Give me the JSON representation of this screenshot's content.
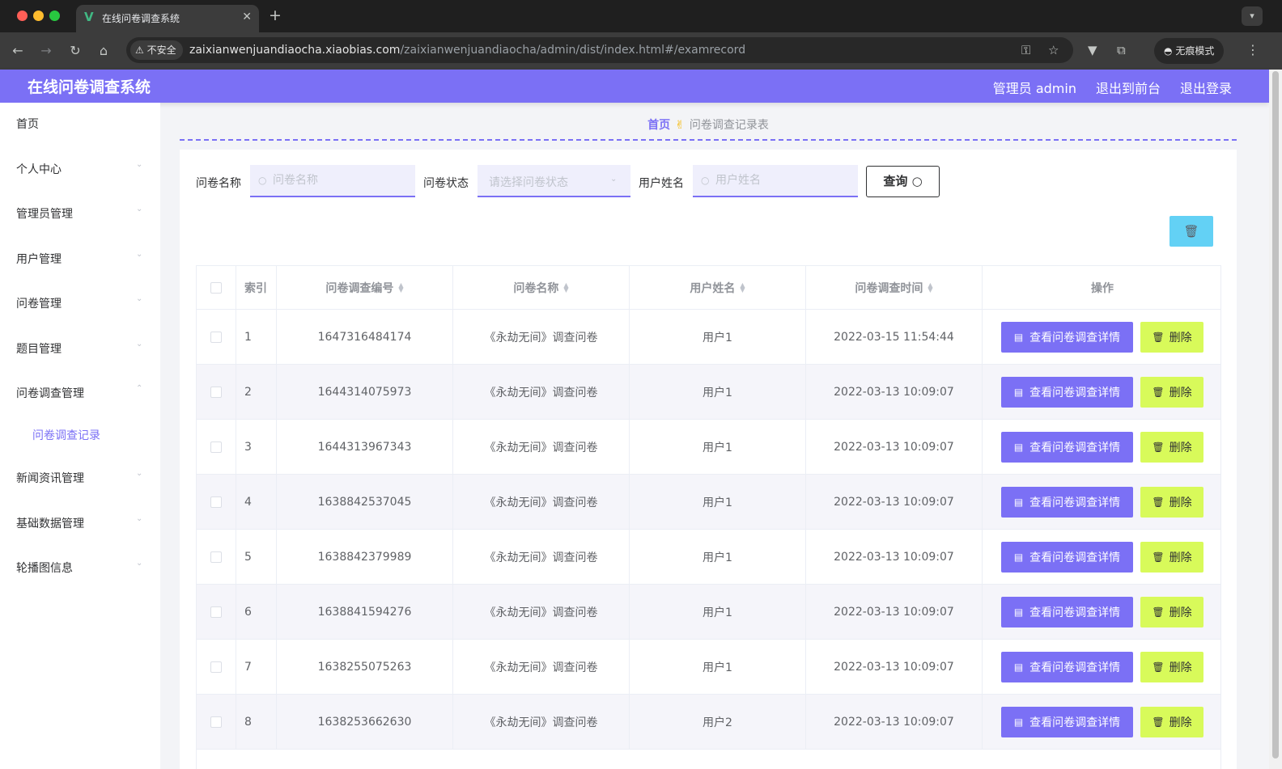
{
  "browser": {
    "tab_title": "在线问卷调查系统",
    "favicon": "V",
    "security_label": "不安全",
    "url_host": "zaixianwenjuandiaocha.xiaobias.com",
    "url_path": "/zaixianwenjuandiaocha/admin/dist/index.html#/examrecord",
    "incognito_label": "无痕模式",
    "icons": [
      "back-icon",
      "forward-icon",
      "reload-icon",
      "home-icon",
      "key-icon",
      "star-icon",
      "vpn-icon",
      "extensions-icon",
      "incognito-icon",
      "more-icon"
    ]
  },
  "header": {
    "title": "在线问卷调查系统",
    "admin_label": "管理员 admin",
    "front_label": "退出到前台",
    "logout_label": "退出登录",
    "accent_color": "#7b70f5"
  },
  "sidebar": {
    "items": [
      {
        "label": "首页"
      },
      {
        "label": "个人中心"
      },
      {
        "label": "管理员管理"
      },
      {
        "label": "用户管理"
      },
      {
        "label": "问卷管理"
      },
      {
        "label": "题目管理"
      },
      {
        "label": "问卷调查管理",
        "expanded": true
      },
      {
        "label": "问卷调查记录",
        "sub": true,
        "active": true
      },
      {
        "label": "新闻资讯管理"
      },
      {
        "label": "基础数据管理"
      },
      {
        "label": "轮播图信息"
      }
    ]
  },
  "breadcrumb": {
    "home": "首页",
    "separator": "✌",
    "current": "问卷调查记录表"
  },
  "search": {
    "name_label": "问卷名称",
    "name_placeholder": "问卷名称",
    "status_label": "问卷状态",
    "status_placeholder": "请选择问卷状态",
    "user_label": "用户姓名",
    "user_placeholder": "用户姓名",
    "query_label": "查询"
  },
  "table": {
    "headers": {
      "index": "索引",
      "no": "问卷调查编号",
      "name": "问卷名称",
      "user": "用户姓名",
      "time": "问卷调查时间",
      "ops": "操作"
    },
    "detail_label": "查看问卷调查详情",
    "delete_label": "删除",
    "rows": [
      {
        "index": "1",
        "no": "1647316484174",
        "name": "《永劫无间》调查问卷",
        "user": "用户1",
        "time": "2022-03-15 11:54:44"
      },
      {
        "index": "2",
        "no": "1644314075973",
        "name": "《永劫无间》调查问卷",
        "user": "用户1",
        "time": "2022-03-13 10:09:07"
      },
      {
        "index": "3",
        "no": "1644313967343",
        "name": "《永劫无间》调查问卷",
        "user": "用户1",
        "time": "2022-03-13 10:09:07"
      },
      {
        "index": "4",
        "no": "1638842537045",
        "name": "《永劫无间》调查问卷",
        "user": "用户1",
        "time": "2022-03-13 10:09:07"
      },
      {
        "index": "5",
        "no": "1638842379989",
        "name": "《永劫无间》调查问卷",
        "user": "用户1",
        "time": "2022-03-13 10:09:07"
      },
      {
        "index": "6",
        "no": "1638841594276",
        "name": "《永劫无间》调查问卷",
        "user": "用户1",
        "time": "2022-03-13 10:09:07"
      },
      {
        "index": "7",
        "no": "1638255075263",
        "name": "《永劫无间》调查问卷",
        "user": "用户1",
        "time": "2022-03-13 10:09:07"
      },
      {
        "index": "8",
        "no": "1638253662630",
        "name": "《永劫无间》调查问卷",
        "user": "用户2",
        "time": "2022-03-13 10:09:07"
      }
    ]
  }
}
